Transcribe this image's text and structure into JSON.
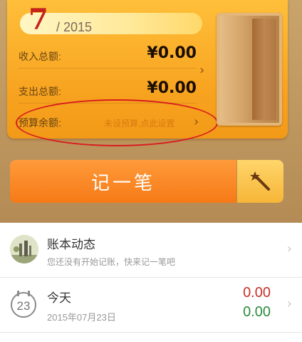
{
  "summary": {
    "month": "7",
    "year": "/ 2015",
    "income_label": "收入总额:",
    "income_value": "¥0.00",
    "expense_label": "支出总额:",
    "expense_value": "¥0.00",
    "budget_label": "预算余额:",
    "budget_hint": "未设预算,点此设置"
  },
  "record_button": {
    "label": "记一笔",
    "magic_icon": "magic-wand-icon"
  },
  "list": {
    "feed": {
      "title": "账本动态",
      "subtitle": "您还没有开始记账，快来记一笔吧"
    },
    "today": {
      "calendar_day": "23",
      "title": "今天",
      "date": "2015年07月23日",
      "expense": "0.00",
      "income": "0.00"
    }
  },
  "colors": {
    "accent_orange": "#f67a17",
    "expense_red": "#c9302c",
    "income_green": "#2d8a3e",
    "annotation_red": "#d81e1e"
  }
}
